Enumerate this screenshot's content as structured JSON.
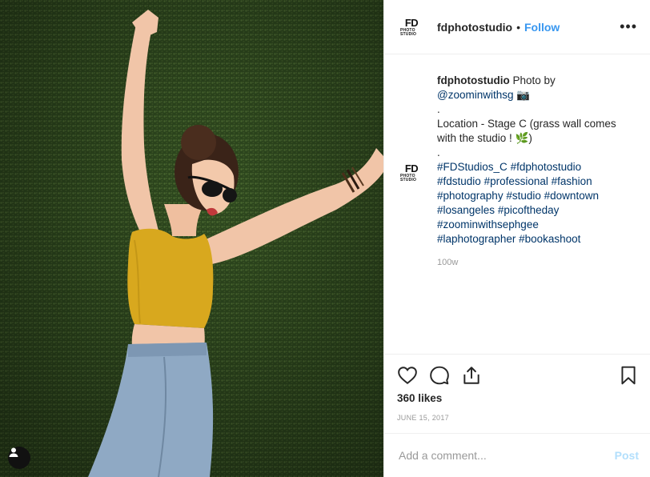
{
  "header": {
    "username": "fdphotostudio",
    "dot": "•",
    "follow_label": "Follow",
    "more_label": "•••"
  },
  "logo": {
    "big": "FD",
    "small": "PHOTO STUDIO",
    "tiny": ""
  },
  "caption": {
    "username": "fdphotostudio",
    "line1": " Photo by",
    "mention": "@zoominwithsg",
    "emoji1": " 📷",
    "sep1": ".",
    "location": "Location - Stage C (grass wall comes with the studio ! ",
    "emoji2": "🌿",
    "location_end": ")",
    "sep2": ".",
    "hashtags": [
      "#FDStudios_C",
      "#fdphotostudio",
      "#fdstudio",
      "#professional",
      "#fashion",
      "#photography",
      "#studio",
      "#downtown",
      "#losangeles",
      "#picoftheday",
      "#zoominwithsephgee",
      "#laphotographer",
      "#bookashoot"
    ],
    "age": "100w"
  },
  "actions": {
    "icons": [
      "heart-icon",
      "comment-icon",
      "share-icon",
      "bookmark-icon"
    ]
  },
  "likes": "360 likes",
  "date": "JUNE 15, 2017",
  "comment": {
    "placeholder": "Add a comment...",
    "post_label": "Post"
  },
  "colors": {
    "link": "#003569",
    "follow": "#3897f0",
    "post_disabled": "#b2dffc",
    "muted": "#999999"
  }
}
